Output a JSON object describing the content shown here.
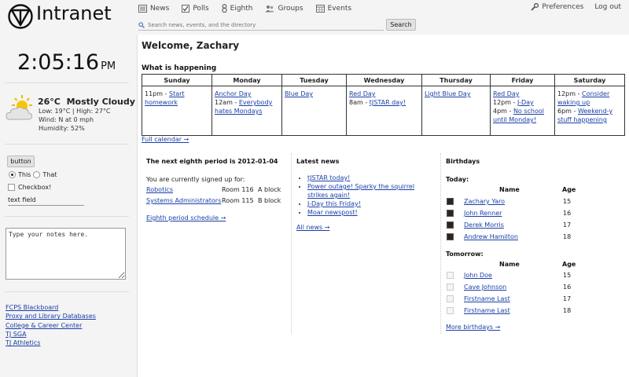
{
  "brand": "Intranet",
  "nav": [
    {
      "label": "News",
      "icon": "news-icon"
    },
    {
      "label": "Polls",
      "icon": "polls-icon"
    },
    {
      "label": "Eighth",
      "icon": "eighth-icon"
    },
    {
      "label": "Groups",
      "icon": "groups-icon"
    },
    {
      "label": "Events",
      "icon": "events-icon"
    }
  ],
  "search": {
    "placeholder": "Search news, events, and the directory",
    "button": "Search"
  },
  "header_right": {
    "preferences": "Preferences",
    "logout": "Log out"
  },
  "sidebar": {
    "clock": {
      "time": "2:05:16",
      "ampm": "PM"
    },
    "weather": {
      "temp": "26°C",
      "condition": "Mostly Cloudy",
      "range": "Low: 19°C | High: 27°C",
      "wind": "Wind: N at 0 mph",
      "humidity": "Humidity: 52%"
    },
    "widgets": {
      "button": "button",
      "radio_this": "This",
      "radio_that": "That",
      "checkbox": "Checkbox!",
      "text_field": "text field"
    },
    "notes": "Type your notes here.",
    "links": [
      "FCPS Blackboard",
      "Proxy and Library Databases",
      "College & Career Center",
      "TJ SGA",
      "TJ Athletics"
    ]
  },
  "main": {
    "welcome": "Welcome, Zachary",
    "happening": "What is happening",
    "full_calendar": "Full calendar →",
    "calendar": {
      "days": [
        "Sunday",
        "Monday",
        "Tuesday",
        "Wednesday",
        "Thursday",
        "Friday",
        "Saturday"
      ],
      "events": [
        [
          {
            "time": "11pm - ",
            "title": "Start homework"
          }
        ],
        [
          {
            "time": "",
            "title": "Anchor Day"
          },
          {
            "time": "12am - ",
            "title": "Everybody hates Mondays"
          }
        ],
        [
          {
            "time": "",
            "title": "Blue Day"
          }
        ],
        [
          {
            "time": "",
            "title": "Red Day"
          },
          {
            "time": "8am - ",
            "title": "tJSTAR day!"
          }
        ],
        [
          {
            "time": "",
            "title": "Light Blue Day"
          }
        ],
        [
          {
            "time": "",
            "title": "Red Day"
          },
          {
            "time": "12pm - ",
            "title": "J-Day"
          },
          {
            "time": "4pm - ",
            "title": "No school until Monday!"
          }
        ],
        [
          {
            "time": "12pm - ",
            "title": "Consider waking up"
          },
          {
            "time": "6pm - ",
            "title": "Weekend-y stuff happening"
          }
        ]
      ]
    },
    "eighth": {
      "title": "The next eighth period is 2012-01-04",
      "signed_up": "You are currently signed up for:",
      "activities": [
        {
          "name": "Robotics",
          "room": "Room 116",
          "block": "A block"
        },
        {
          "name": "Systems Administrators",
          "room": "Room 115",
          "block": "B block"
        }
      ],
      "schedule_link": "Eighth period schedule →"
    },
    "news": {
      "title": "Latest news",
      "items": [
        "tJSTAR today!",
        "Power outage! Sparky the squirrel strikes again!",
        "J-Day this Friday!",
        "Moar newspost!"
      ],
      "all_link": "All news →"
    },
    "birthdays": {
      "title": "Birthdays",
      "today_label": "Today:",
      "tomorrow_label": "Tomorrow:",
      "col_name": "Name",
      "col_age": "Age",
      "today": [
        {
          "name": "Zachary Yaro",
          "age": "15"
        },
        {
          "name": "John Renner",
          "age": "16"
        },
        {
          "name": "Derek Morris",
          "age": "17"
        },
        {
          "name": "Andrew Hamilton",
          "age": "18"
        }
      ],
      "tomorrow": [
        {
          "name": "John Doe",
          "age": "15"
        },
        {
          "name": "Cave Johnson",
          "age": "16"
        },
        {
          "name": "Firstname Last",
          "age": "17"
        },
        {
          "name": "Firstname Last",
          "age": "18"
        }
      ],
      "more_link": "More birthdays →"
    }
  }
}
